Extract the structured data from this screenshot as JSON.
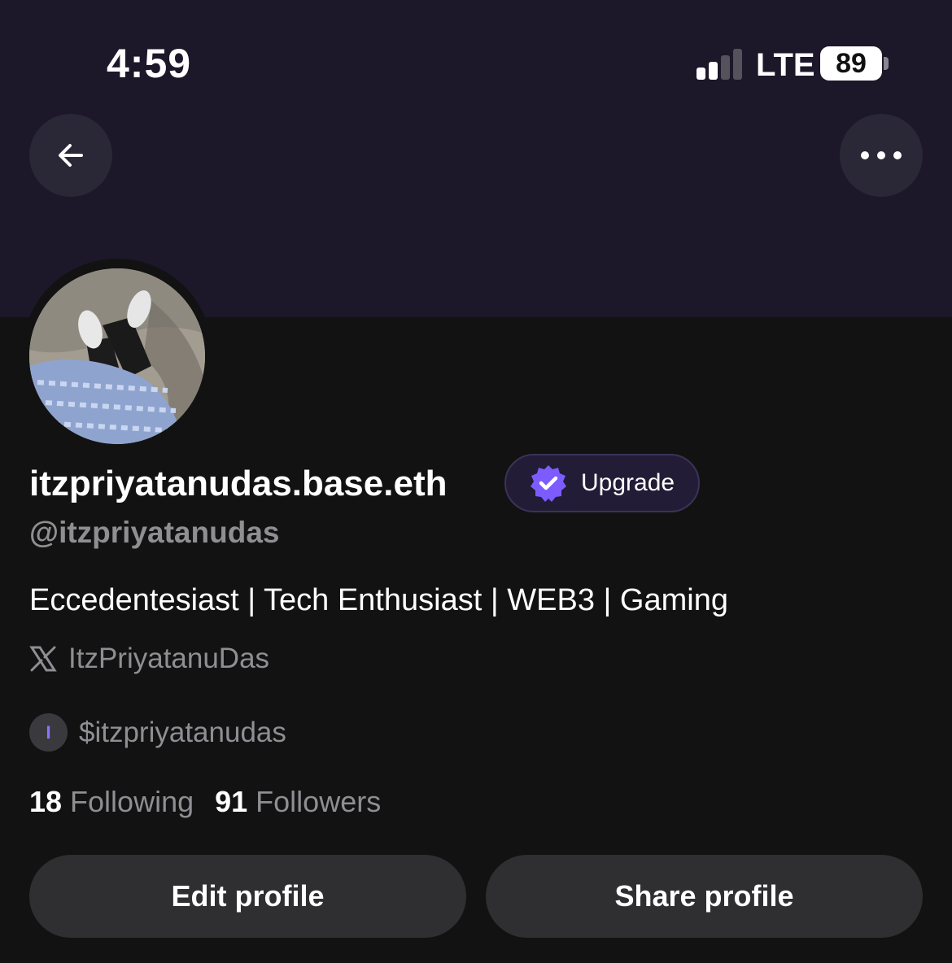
{
  "status_bar": {
    "time": "4:59",
    "network": "LTE",
    "battery": "89"
  },
  "header": {
    "back_icon": "arrow-left-icon",
    "more_icon": "ellipsis-icon"
  },
  "profile": {
    "display_name": "itzpriyatanudas.base.eth",
    "upgrade_label": "Upgrade",
    "username": "@itzpriyatanudas",
    "bio": "Eccedentesiast | Tech Enthusiast | WEB3 | Gaming",
    "x_handle": "ItzPriyatanuDas",
    "token_letter": "I",
    "token": "$itzpriyatanudas",
    "following_count": "18",
    "following_label": "Following",
    "followers_count": "91",
    "followers_label": "Followers"
  },
  "actions": {
    "edit_label": "Edit profile",
    "share_label": "Share profile"
  },
  "colors": {
    "banner": "#1d172a",
    "background": "#121212",
    "accent": "#8a74ff",
    "secondary_text": "#8e8e93",
    "button": "#2f2f31"
  }
}
